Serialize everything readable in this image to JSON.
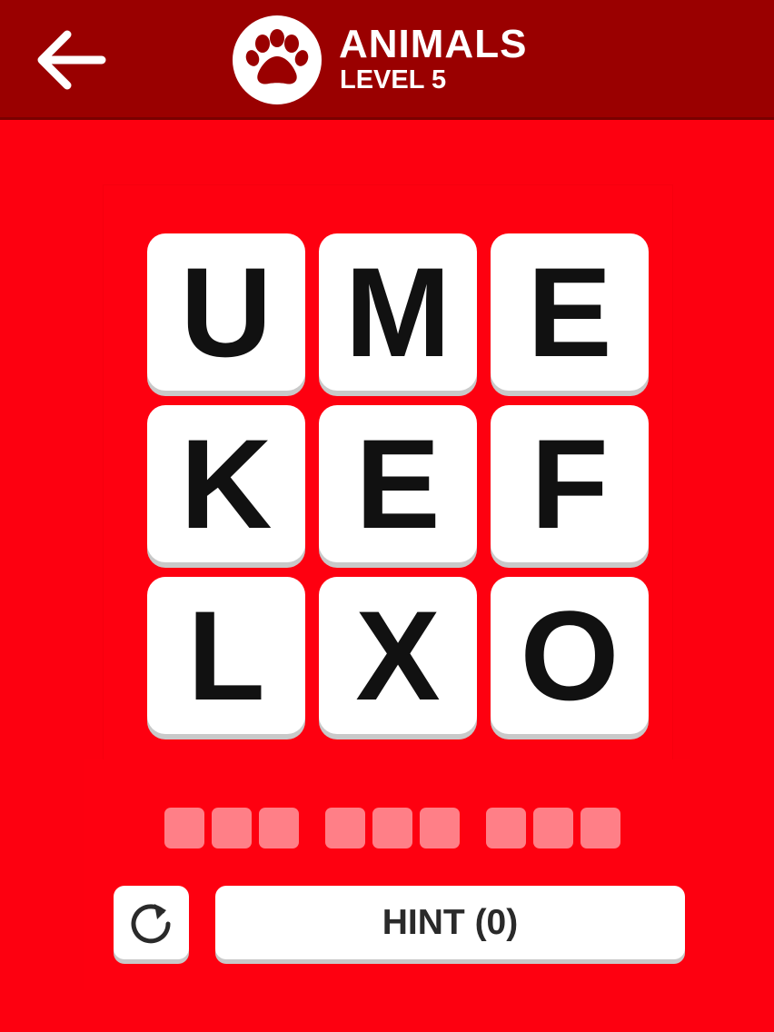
{
  "header": {
    "back_icon": "arrow-left-icon",
    "category_icon": "paw-icon",
    "category": "ANIMALS",
    "level": "LEVEL 5"
  },
  "board": {
    "tiles": [
      "U",
      "M",
      "E",
      "K",
      "E",
      "F",
      "L",
      "X",
      "O"
    ]
  },
  "answer": {
    "word_lengths": [
      3,
      3,
      3
    ],
    "filled": ""
  },
  "controls": {
    "reset_icon": "reset-icon",
    "hint_label": "HINT (0)"
  },
  "colors": {
    "background": "#fd0010",
    "header": "#9a0000",
    "tile": "#ffffff",
    "slot": "#ff7f87"
  }
}
